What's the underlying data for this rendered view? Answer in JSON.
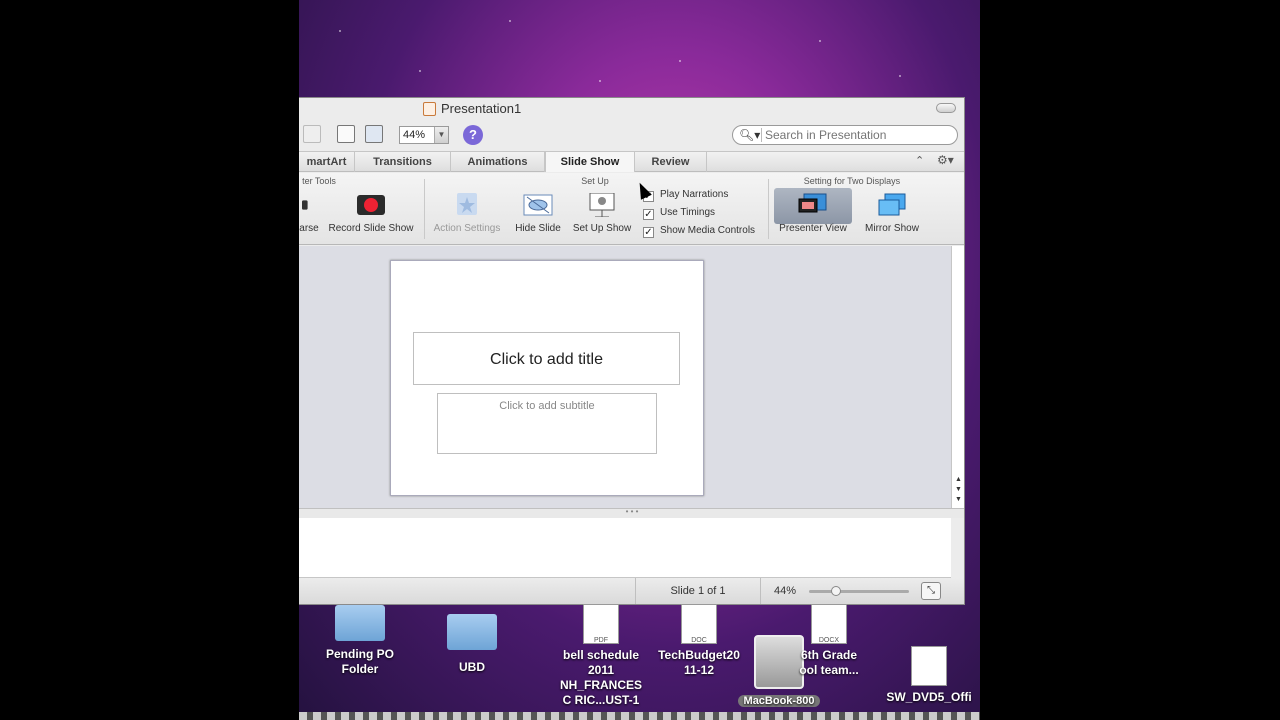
{
  "window": {
    "title": "Presentation1",
    "zoom_value": "44%",
    "help_symbol": "?",
    "search": {
      "placeholder": "Search in Presentation",
      "icon": "magnifier-icon"
    }
  },
  "tabs": [
    {
      "label": "martArt"
    },
    {
      "label": "Transitions"
    },
    {
      "label": "Animations"
    },
    {
      "label": "Slide Show",
      "active": true
    },
    {
      "label": "Review"
    }
  ],
  "ribbon": {
    "groups": {
      "presenter_tools": "ter Tools",
      "set_up": "Set Up",
      "two_displays": "Setting for Two Displays"
    },
    "buttons": {
      "rehearse": "arse",
      "record": "Record Slide Show",
      "action_settings": "Action Settings",
      "hide_slide": "Hide Slide",
      "set_up_show": "Set Up Show",
      "presenter_view": "Presenter View",
      "mirror_show": "Mirror Show"
    },
    "checkboxes": [
      {
        "label": "Play Narrations",
        "checked": true
      },
      {
        "label": "Use Timings",
        "checked": true
      },
      {
        "label": "Show Media Controls",
        "checked": true
      }
    ]
  },
  "slide": {
    "title_placeholder": "Click to add title",
    "subtitle_placeholder": "Click to add subtitle"
  },
  "status": {
    "slide_count": "Slide 1 of 1",
    "zoom": "44%"
  },
  "desktop": {
    "icons": [
      {
        "label": "Pending PO\nFolder",
        "type": "folder"
      },
      {
        "label": "UBD",
        "type": "folder"
      },
      {
        "label": "bell schedule\n2011 NH_FRANCES\nC RIC...UST-1",
        "type": "doc",
        "badge": "PDF"
      },
      {
        "label": "TechBudget20\n11-12",
        "type": "doc",
        "badge": "DOC"
      },
      {
        "label": "MacBook-800",
        "type": "drive"
      },
      {
        "label": "6th Grade\nool team...",
        "type": "doc",
        "badge": "DOCX"
      },
      {
        "label": "SW_DVD5_Offi",
        "type": "doc",
        "badge": ""
      }
    ]
  }
}
